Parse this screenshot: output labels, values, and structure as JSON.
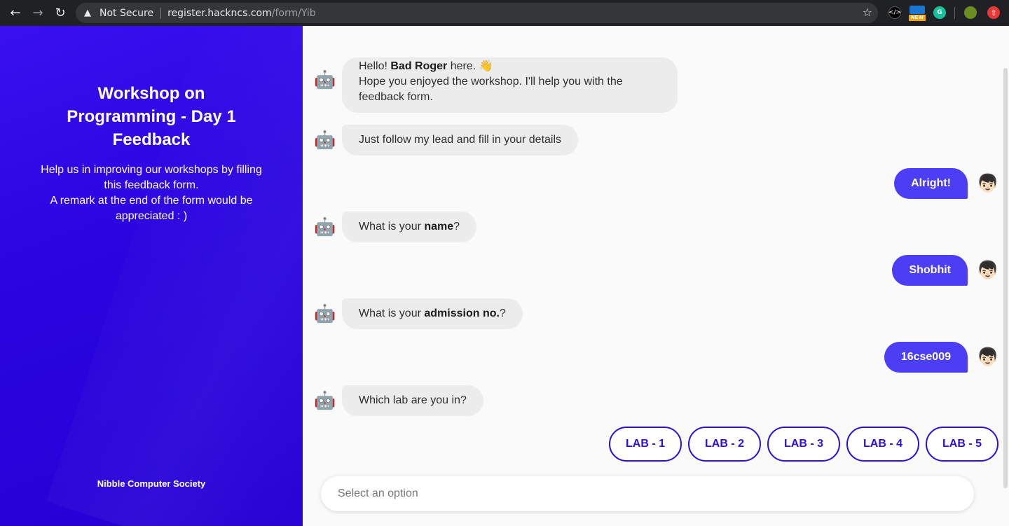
{
  "browser": {
    "security_label": "Not Secure",
    "url_host": "register.hackncs.com",
    "url_path": "/form/Yib",
    "ext_new_label": "NEW",
    "ext_grammarly_label": "G"
  },
  "sidebar": {
    "title": "Workshop on Programming - Day 1 Feedback",
    "description_line1": "Help us in improving our workshops by filling this feedback form.",
    "description_line2": "A remark at the end of the form would be appreciated : )",
    "org": "Nibble Computer Society"
  },
  "chat": {
    "greeting_prefix": "Hello! ",
    "bot_name": "Bad Roger",
    "greeting_suffix": " here. 👋",
    "greeting_line2": "Hope you enjoyed the workshop. I'll help you with the feedback form.",
    "msg_follow": "Just follow my lead and fill in your details",
    "reply_alright": "Alright!",
    "q_name_prefix": "What is your ",
    "q_name_bold": "name",
    "q_name_suffix": "?",
    "reply_name": "Shobhit",
    "q_adm_prefix": "What is your ",
    "q_adm_bold": "admission no.",
    "q_adm_suffix": "?",
    "reply_adm": "16cse009",
    "q_lab": "Which lab are you in?",
    "bot_avatar": "🤖",
    "user_avatar": "👦🏻"
  },
  "options": [
    "LAB - 1",
    "LAB - 2",
    "LAB - 3",
    "LAB - 4",
    "LAB - 5"
  ],
  "input": {
    "placeholder": "Select an option"
  },
  "colors": {
    "panel": "#2a05e0",
    "user_bubble": "#4b3ef5",
    "option_border": "#2f0ed8",
    "bot_bubble": "#ececec"
  }
}
